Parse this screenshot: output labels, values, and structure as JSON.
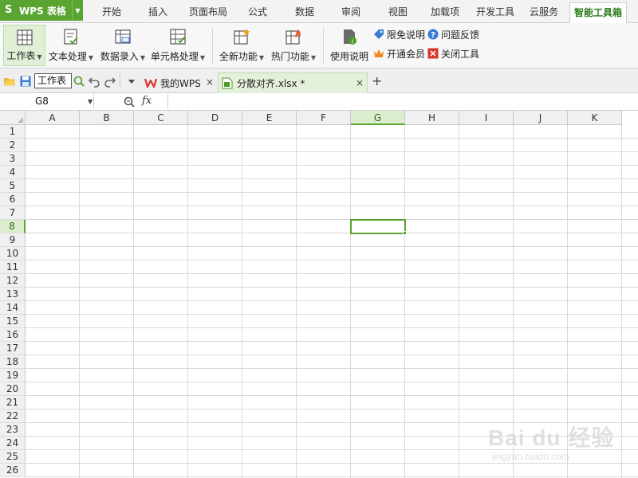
{
  "app": {
    "title": "WPS 表格",
    "logo": "S"
  },
  "menu": {
    "tabs": [
      {
        "label": "开始"
      },
      {
        "label": "插入"
      },
      {
        "label": "页面布局"
      },
      {
        "label": "公式"
      },
      {
        "label": "数据"
      },
      {
        "label": "审阅"
      },
      {
        "label": "视图"
      },
      {
        "label": "加载项"
      },
      {
        "label": "开发工具"
      },
      {
        "label": "云服务"
      },
      {
        "label": "智能工具箱"
      }
    ],
    "active": "智能工具箱"
  },
  "ribbon": {
    "buttons": [
      {
        "label": "工作表",
        "icon": "worksheet-icon",
        "dropdown": true
      },
      {
        "label": "文本处理",
        "icon": "text-process-icon",
        "dropdown": true
      },
      {
        "label": "数据录入",
        "icon": "data-entry-icon",
        "dropdown": true
      },
      {
        "label": "单元格处理",
        "icon": "cell-process-icon",
        "dropdown": true
      },
      {
        "label": "全新功能",
        "icon": "new-feature-icon",
        "dropdown": true
      },
      {
        "label": "热门功能",
        "icon": "hot-feature-icon",
        "dropdown": true
      },
      {
        "label": "使用说明",
        "icon": "help-doc-icon",
        "dropdown": false
      }
    ],
    "small": [
      {
        "label": "限免说明",
        "icon": "tag-icon"
      },
      {
        "label": "问题反馈",
        "icon": "question-icon"
      },
      {
        "label": "开通会员",
        "icon": "crown-icon"
      },
      {
        "label": "关闭工具",
        "icon": "close-tool-icon"
      }
    ]
  },
  "tabbar": {
    "sheet_input": "工作表",
    "tabs": [
      {
        "label": "我的WPS",
        "icon": "wps-icon"
      },
      {
        "label": "分散对齐.xlsx *",
        "icon": "xlsx-file-icon"
      }
    ],
    "close_glyph": "×",
    "add_glyph": "+"
  },
  "formula": {
    "name_box": "G8",
    "fx_label": "fx",
    "value": ""
  },
  "grid": {
    "columns": [
      "A",
      "B",
      "C",
      "D",
      "E",
      "F",
      "G",
      "H",
      "I",
      "J",
      "K"
    ],
    "rows": [
      "1",
      "2",
      "3",
      "4",
      "5",
      "6",
      "7",
      "8",
      "9",
      "10",
      "11",
      "12",
      "13",
      "14",
      "15",
      "16",
      "17",
      "18",
      "19",
      "20",
      "21",
      "22",
      "23",
      "24",
      "25",
      "26"
    ],
    "active_column": "G",
    "active_row": "8"
  },
  "watermark": {
    "main": "Bai du 经验",
    "sub": "jingyan.baidu.com"
  },
  "colors": {
    "accent": "#5aa532",
    "selected_bg": "#dceccf"
  }
}
